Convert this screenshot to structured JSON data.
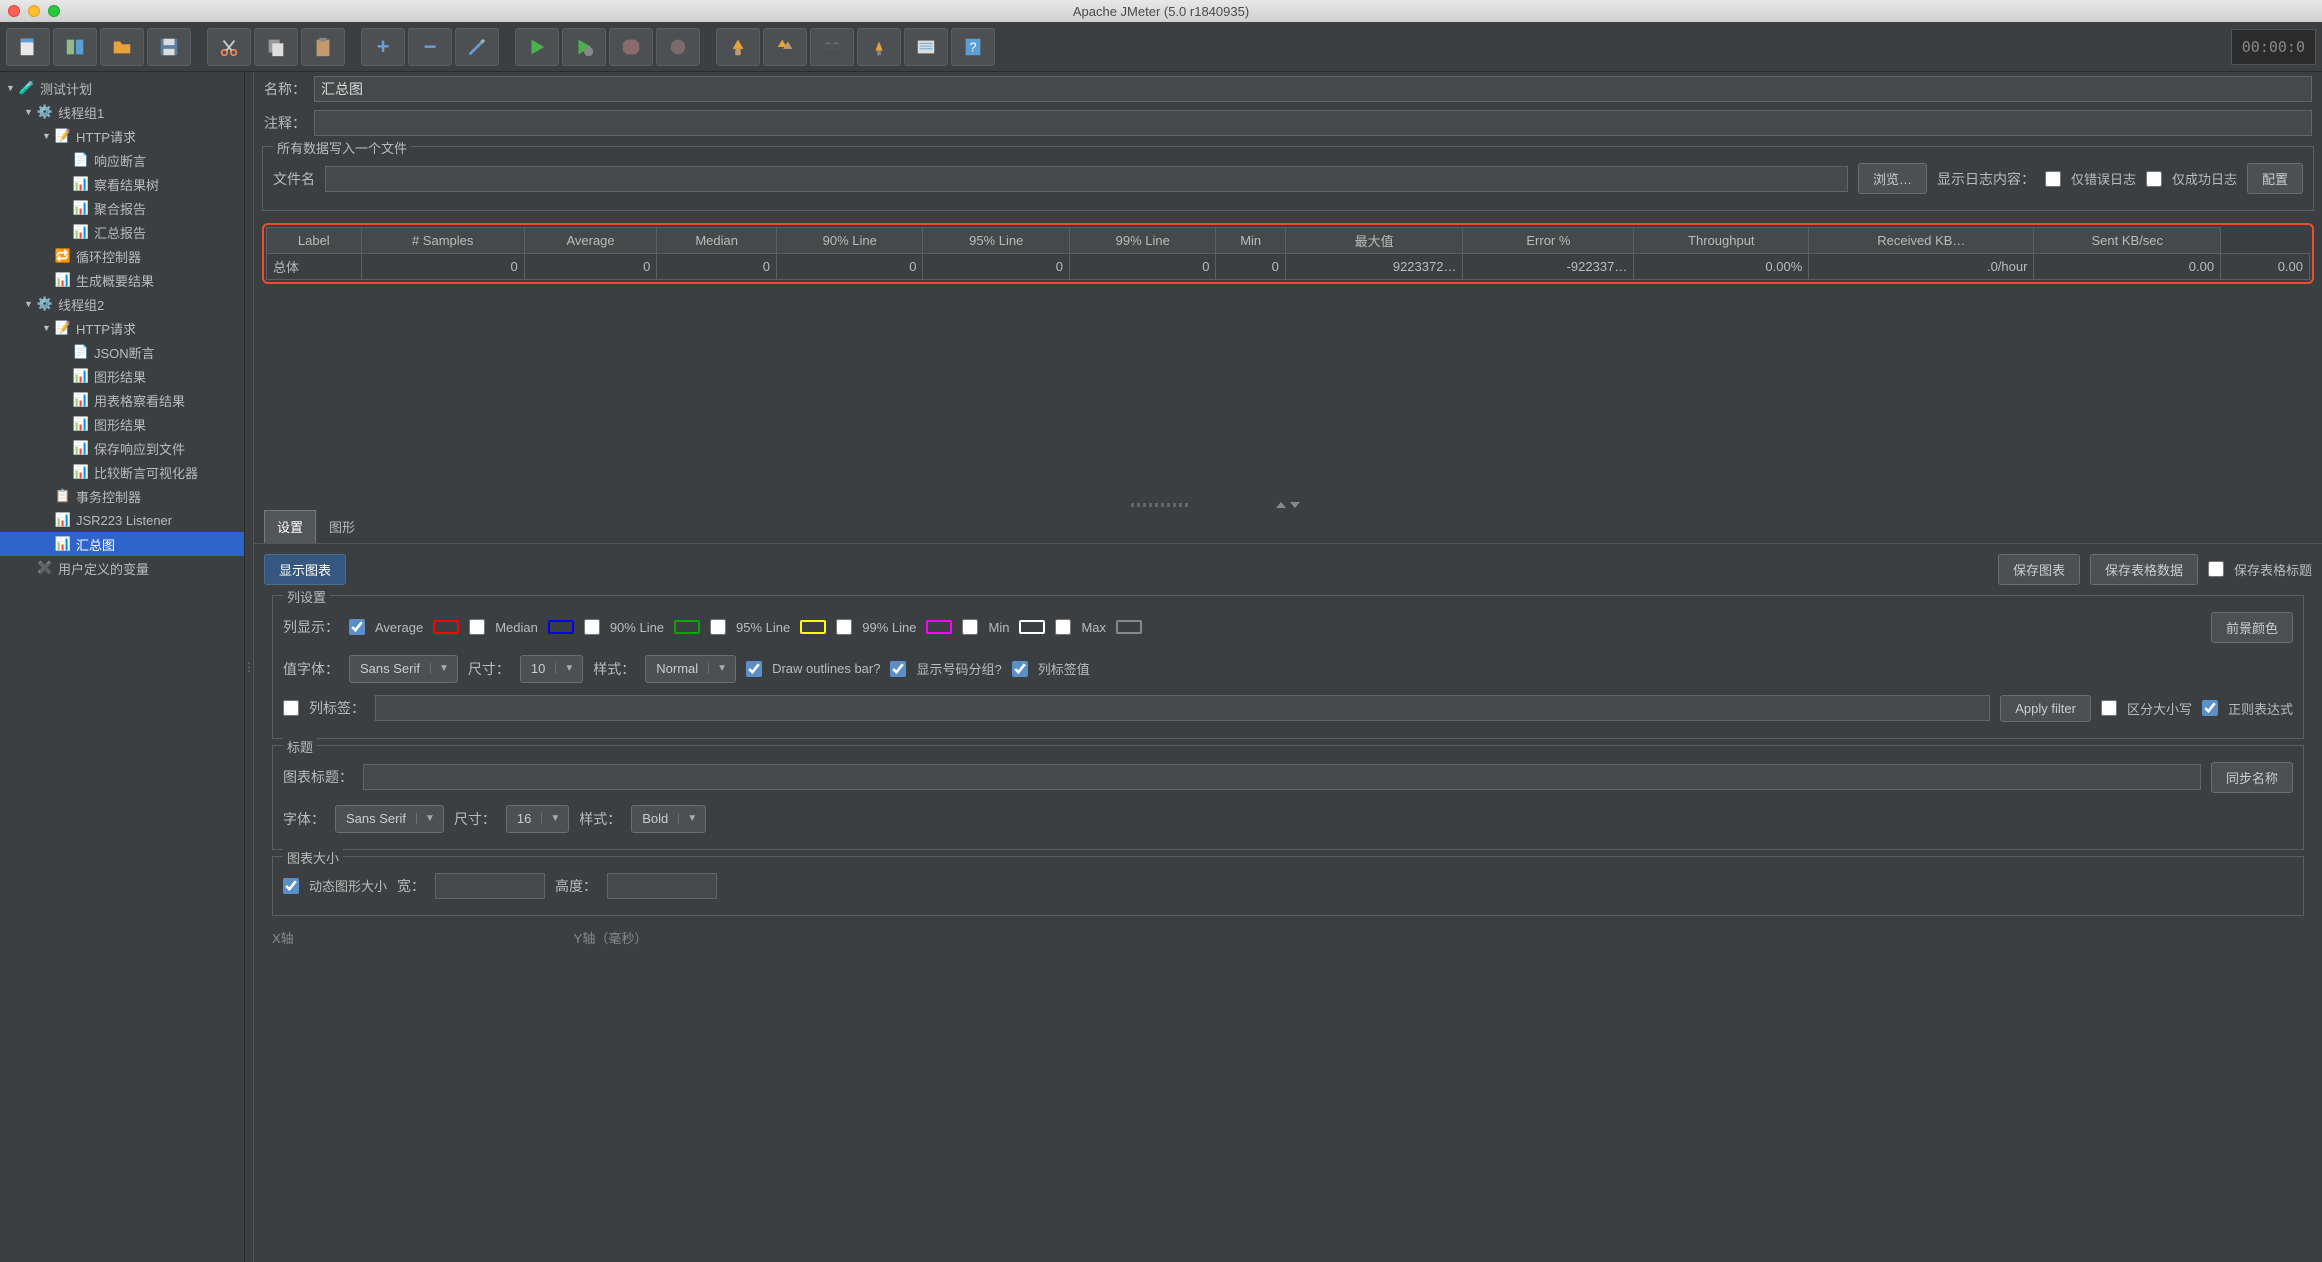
{
  "window": {
    "title": "Apache JMeter (5.0 r1840935)"
  },
  "timer": "00:00:0",
  "tree": [
    {
      "indent": 0,
      "toggle": "▼",
      "icon": "flask",
      "label": "测试计划"
    },
    {
      "indent": 1,
      "toggle": "▼",
      "icon": "gear",
      "label": "线程组1"
    },
    {
      "indent": 2,
      "toggle": "▼",
      "icon": "pipette",
      "label": "HTTP请求"
    },
    {
      "indent": 3,
      "toggle": "",
      "icon": "doc",
      "label": "响应断言"
    },
    {
      "indent": 3,
      "toggle": "",
      "icon": "chart",
      "label": "察看结果树"
    },
    {
      "indent": 3,
      "toggle": "",
      "icon": "chart",
      "label": "聚合报告"
    },
    {
      "indent": 3,
      "toggle": "",
      "icon": "chart",
      "label": "汇总报告"
    },
    {
      "indent": 2,
      "toggle": "",
      "icon": "loop",
      "label": "循环控制器"
    },
    {
      "indent": 2,
      "toggle": "",
      "icon": "chart",
      "label": "生成概要结果"
    },
    {
      "indent": 1,
      "toggle": "▼",
      "icon": "gear",
      "label": "线程组2"
    },
    {
      "indent": 2,
      "toggle": "▼",
      "icon": "pipette",
      "label": "HTTP请求"
    },
    {
      "indent": 3,
      "toggle": "",
      "icon": "doc",
      "label": "JSON断言"
    },
    {
      "indent": 3,
      "toggle": "",
      "icon": "chart",
      "label": "图形结果"
    },
    {
      "indent": 3,
      "toggle": "",
      "icon": "chart",
      "label": "用表格察看结果"
    },
    {
      "indent": 3,
      "toggle": "",
      "icon": "chart",
      "label": "图形结果"
    },
    {
      "indent": 3,
      "toggle": "",
      "icon": "chart",
      "label": "保存响应到文件"
    },
    {
      "indent": 3,
      "toggle": "",
      "icon": "chart",
      "label": "比较断言可视化器"
    },
    {
      "indent": 2,
      "toggle": "",
      "icon": "txn",
      "label": "事务控制器"
    },
    {
      "indent": 2,
      "toggle": "",
      "icon": "chart",
      "label": "JSR223 Listener"
    },
    {
      "indent": 2,
      "toggle": "",
      "icon": "chart",
      "label": "汇总图",
      "selected": true
    },
    {
      "indent": 1,
      "toggle": "",
      "icon": "vars",
      "label": "用户定义的变量"
    }
  ],
  "form": {
    "name_label": "名称：",
    "name_value": "汇总图",
    "comment_label": "注释：",
    "file_fieldset": "所有数据写入一个文件",
    "filename_label": "文件名",
    "browse": "浏览…",
    "log_label": "显示日志内容：",
    "err_only": "仅错误日志",
    "succ_only": "仅成功日志",
    "configure": "配置"
  },
  "table": {
    "headers": [
      "Label",
      "# Samples",
      "Average",
      "Median",
      "90% Line",
      "95% Line",
      "99% Line",
      "Min",
      "最大值",
      "Error %",
      "Throughput",
      "Received KB…",
      "Sent KB/sec"
    ],
    "row": [
      "总体",
      "0",
      "0",
      "0",
      "0",
      "0",
      "0",
      "0",
      "9223372…",
      "-922337…",
      "0.00%",
      ".0/hour",
      "0.00",
      "0.00"
    ]
  },
  "tabs": {
    "settings": "设置",
    "graph": "图形"
  },
  "actions": {
    "display_graph": "显示图表",
    "save_graph": "保存图表",
    "save_table": "保存表格数据",
    "save_header": "保存表格标题"
  },
  "column": {
    "fieldset": "列设置",
    "display_label": "列显示：",
    "avg": "Average",
    "median": "Median",
    "p90": "90% Line",
    "p95": "95% Line",
    "p99": "99% Line",
    "min": "Min",
    "max": "Max",
    "fg_color": "前景颜色",
    "value_font": "值字体：",
    "font_family": "Sans Serif",
    "size_label": "尺寸：",
    "size_value": "10",
    "style_label": "样式：",
    "style_value": "Normal",
    "draw_outline": "Draw outlines bar?",
    "group_num": "显示号码分组?",
    "col_label_val": "列标签值",
    "col_label": "列标签：",
    "apply_filter": "Apply filter",
    "case_sens": "区分大小写",
    "regex": "正则表达式"
  },
  "title_section": {
    "fieldset": "标题",
    "chart_title_label": "图表标题：",
    "sync_name": "同步名称",
    "font_label": "字体：",
    "font_family": "Sans Serif",
    "size_label": "尺寸：",
    "size_value": "16",
    "style_label": "样式：",
    "style_value": "Bold"
  },
  "size_section": {
    "fieldset": "图表大小",
    "dynamic": "动态图形大小",
    "width_label": "宽：",
    "height_label": "高度："
  },
  "axis": {
    "x_label": "X轴",
    "y_label": "Y轴（毫秒）"
  }
}
